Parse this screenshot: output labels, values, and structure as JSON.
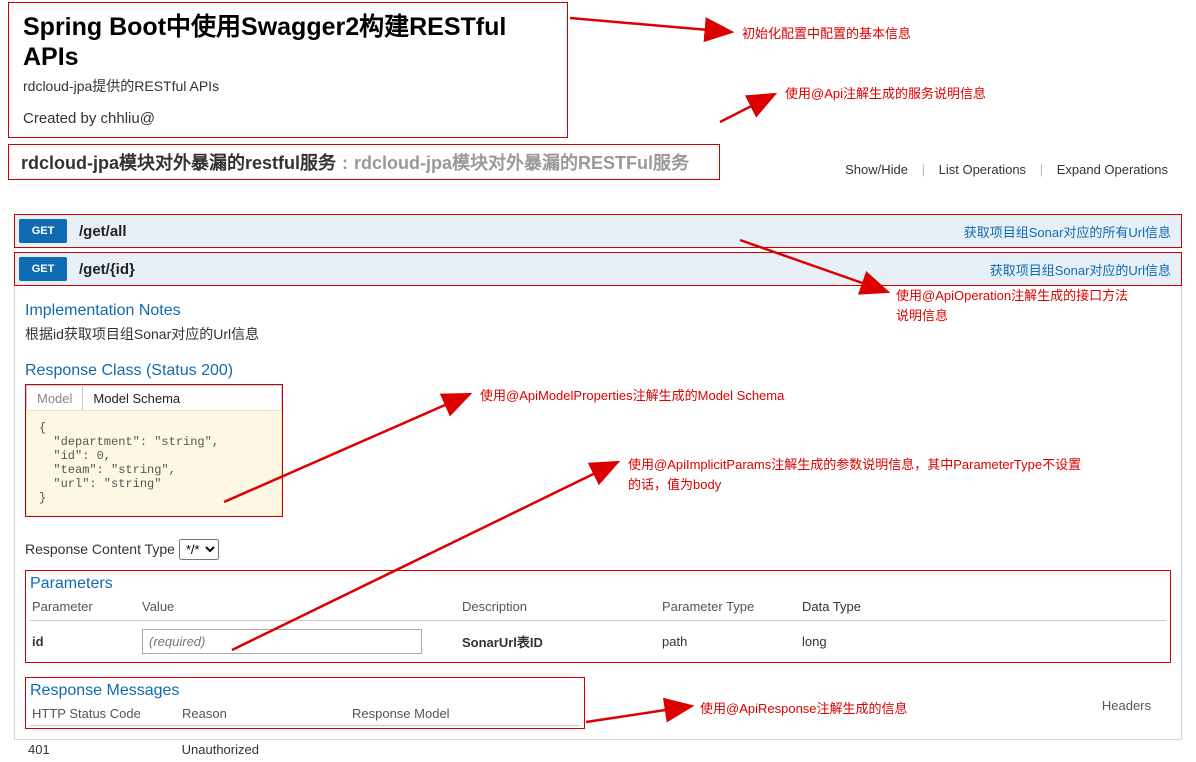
{
  "header": {
    "title": "Spring Boot中使用Swagger2构建RESTful APIs",
    "description": "rdcloud-jpa提供的RESTful APIs",
    "created_by": "Created by chhliu@"
  },
  "api_tag": {
    "name": "rdcloud-jpa模块对外暴漏的restful服务",
    "separator": " : ",
    "desc": "rdcloud-jpa模块对外暴漏的RESTFul服务"
  },
  "ops_links": {
    "show_hide": "Show/Hide",
    "list": "List Operations",
    "expand": "Expand Operations"
  },
  "endpoints": [
    {
      "method": "GET",
      "path": "/get/all",
      "summary": "获取项目组Sonar对应的所有Url信息"
    },
    {
      "method": "GET",
      "path": "/get/{id}",
      "summary": "获取项目组Sonar对应的Url信息"
    }
  ],
  "impl_notes": {
    "title": "Implementation Notes",
    "text": "根据id获取项目组Sonar对应的Url信息"
  },
  "response_class": {
    "title": "Response Class (Status 200)",
    "tabs": {
      "model": "Model",
      "schema": "Model Schema"
    },
    "schema_json": "{\n  \"department\": \"string\",\n  \"id\": 0,\n  \"team\": \"string\",\n  \"url\": \"string\"\n}"
  },
  "response_content_type": {
    "label": "Response Content Type",
    "value": "*/*"
  },
  "parameters": {
    "title": "Parameters",
    "headers": {
      "name": "Parameter",
      "value": "Value",
      "desc": "Description",
      "ptype": "Parameter Type",
      "dtype": "Data Type"
    },
    "rows": [
      {
        "name": "id",
        "placeholder": "(required)",
        "desc": "SonarUrl表ID",
        "ptype": "path",
        "dtype": "long"
      }
    ]
  },
  "response_messages": {
    "title": "Response Messages",
    "headers": {
      "code": "HTTP Status Code",
      "reason": "Reason",
      "model": "Response Model",
      "headers": "Headers"
    },
    "rows": [
      {
        "code": "401",
        "reason": "Unauthorized"
      }
    ]
  },
  "annotations": {
    "a1": "初始化配置中配置的基本信息",
    "a2": "使用@Api注解生成的服务说明信息",
    "a3": "使用@ApiOperation注解生成的接口方法\n说明信息",
    "a4": "使用@ApiModelProperties注解生成的Model Schema",
    "a5": "使用@ApiImplicitParams注解生成的参数说明信息，其中ParameterType不设置\n的话，值为body",
    "a6": "使用@ApiResponse注解生成的信息"
  }
}
